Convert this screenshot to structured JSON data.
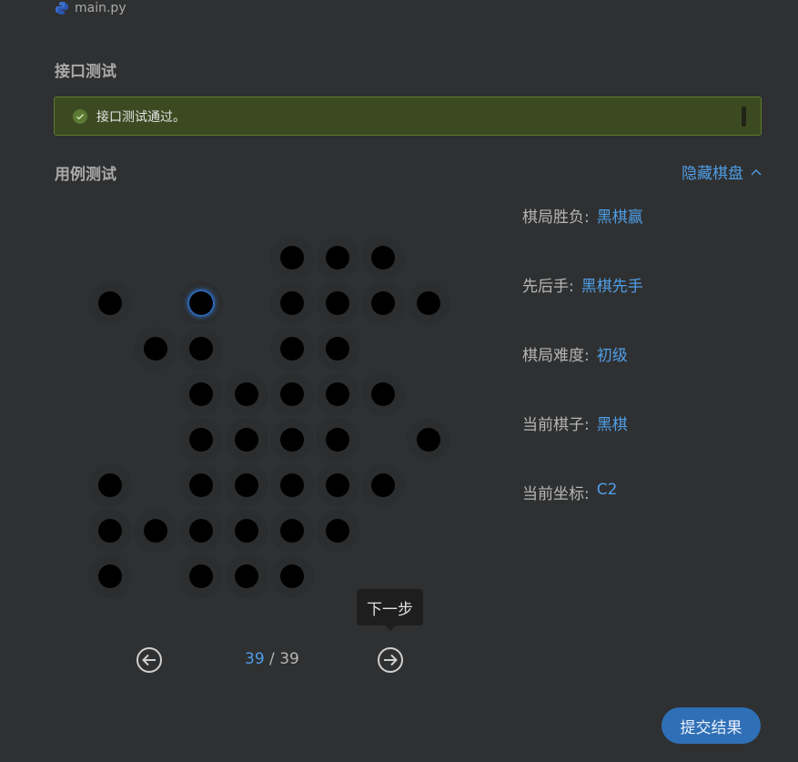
{
  "file_tab": {
    "label": "main.py"
  },
  "api_test": {
    "title": "接口测试",
    "status_text": "接口测试通过。"
  },
  "case_test": {
    "title": "用例测试",
    "toggle_label": "隐藏棋盘"
  },
  "board": {
    "rows": 8,
    "cols": 8,
    "current": [
      1,
      2
    ],
    "stones": [
      [
        0,
        4
      ],
      [
        0,
        5
      ],
      [
        0,
        6
      ],
      [
        1,
        0
      ],
      [
        1,
        2
      ],
      [
        1,
        4
      ],
      [
        1,
        5
      ],
      [
        1,
        6
      ],
      [
        1,
        7
      ],
      [
        2,
        1
      ],
      [
        2,
        2
      ],
      [
        2,
        4
      ],
      [
        2,
        5
      ],
      [
        3,
        2
      ],
      [
        3,
        3
      ],
      [
        3,
        4
      ],
      [
        3,
        5
      ],
      [
        3,
        6
      ],
      [
        4,
        2
      ],
      [
        4,
        3
      ],
      [
        4,
        4
      ],
      [
        4,
        5
      ],
      [
        4,
        7
      ],
      [
        5,
        0
      ],
      [
        5,
        2
      ],
      [
        5,
        3
      ],
      [
        5,
        4
      ],
      [
        5,
        5
      ],
      [
        5,
        6
      ],
      [
        6,
        0
      ],
      [
        6,
        1
      ],
      [
        6,
        2
      ],
      [
        6,
        3
      ],
      [
        6,
        4
      ],
      [
        6,
        5
      ],
      [
        7,
        0
      ],
      [
        7,
        2
      ],
      [
        7,
        3
      ],
      [
        7,
        4
      ]
    ]
  },
  "info": {
    "result_label": "棋局胜负:",
    "result_value": "黑棋赢",
    "first_label": "先后手:",
    "first_value": "黑棋先手",
    "difficulty_label": "棋局难度:",
    "difficulty_value": "初级",
    "piece_label": "当前棋子:",
    "piece_value": "黑棋",
    "coord_label": "当前坐标:",
    "coord_value": "C2"
  },
  "tooltip": {
    "text": "下一步"
  },
  "pager": {
    "current": "39",
    "separator": "/",
    "total": "39"
  },
  "submit": {
    "label": "提交结果"
  },
  "colors": {
    "accent": "#4f9ee8",
    "success_bg": "#3c4a22",
    "background": "#2f3031"
  }
}
